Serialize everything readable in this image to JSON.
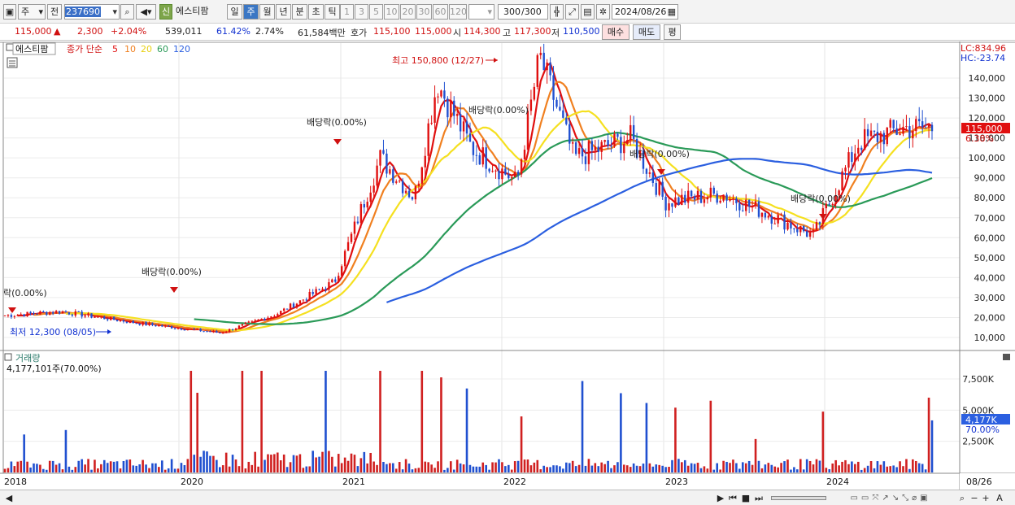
{
  "toolbar": {
    "market": "주",
    "jeon": "전",
    "code": "237690",
    "stock_name": "에스티팜",
    "shin": "신",
    "periods": [
      "일",
      "주",
      "월",
      "년",
      "분",
      "초",
      "틱"
    ],
    "selected_period": "주",
    "intervals": [
      "1",
      "3",
      "5",
      "10",
      "20",
      "30",
      "60",
      "120"
    ],
    "count": "300",
    "count_total": "/300",
    "date": "2024/08/26"
  },
  "info": {
    "price": "115,000",
    "arrow": "▲",
    "change": "2,300",
    "change_pct": "+2.04%",
    "volume": "539,011",
    "ratio1": "61.42%",
    "ratio2": "2.74%",
    "amount": "61,584백만",
    "hoga_label": "호가",
    "hoga1": "115,100",
    "hoga2": "115,000",
    "open_label": "시",
    "open": "114,300",
    "high_label": "고",
    "high": "117,300",
    "low_label": "저",
    "low": "110,500",
    "buy": "매수",
    "sell": "매도",
    "eval": "평"
  },
  "legend": {
    "name": "에스티팜",
    "series": "종가 단순",
    "periods": [
      "5",
      "10",
      "20",
      "60",
      "120"
    ],
    "colors": [
      "#e01010",
      "#f08020",
      "#f5e020",
      "#2a9a58",
      "#2b5fe0"
    ]
  },
  "price_chart": {
    "lc": "LC:834.96",
    "hc": "HC:-23.74",
    "y_ticks": [
      "140,000",
      "130,000",
      "120,000",
      "110,000",
      "100,000",
      "90,000",
      "80,000",
      "70,000",
      "60,000",
      "50,000",
      "40,000",
      "30,000",
      "20,000",
      "10,000"
    ],
    "current_price": "115,000",
    "current_pct": "6.38%",
    "annotations": {
      "high": "최고 150,800 (12/27)",
      "low": "최저 12,300 (08/05)",
      "div1": "락(0.00%)",
      "div2": "배당락(0.00%)",
      "div3": "배당락(0.00%)",
      "div4": "배당락(0.00%)",
      "div5": "배당락(0.00%)",
      "div6": "배당락(0.00%)"
    }
  },
  "volume_chart": {
    "title": "거래량",
    "value": "4,177,101주(70.00%)",
    "y_ticks": [
      "7,500K",
      "5,000K",
      "2,500K"
    ],
    "current": "4,177K",
    "current_pct": "70.00%"
  },
  "x_axis": {
    "labels": [
      "2018",
      "2020",
      "2021",
      "2022",
      "2023",
      "2024"
    ],
    "right_label": "08/26"
  },
  "chart_data": {
    "type": "candlestick",
    "weekly_close_approx": [
      {
        "date": "2018-01",
        "value": 21000
      },
      {
        "date": "2018-06",
        "value": 23000
      },
      {
        "date": "2019-01",
        "value": 17000
      },
      {
        "date": "2019-08",
        "value": 12300
      },
      {
        "date": "2020-01",
        "value": 22000
      },
      {
        "date": "2020-06",
        "value": 38000
      },
      {
        "date": "2020-10",
        "value": 100000
      },
      {
        "date": "2021-01",
        "value": 80000
      },
      {
        "date": "2021-03",
        "value": 138000
      },
      {
        "date": "2021-06",
        "value": 105000
      },
      {
        "date": "2021-10",
        "value": 88000
      },
      {
        "date": "2021-12",
        "value": 150800
      },
      {
        "date": "2022-03",
        "value": 100000
      },
      {
        "date": "2022-08",
        "value": 110000
      },
      {
        "date": "2022-11",
        "value": 78000
      },
      {
        "date": "2023-04",
        "value": 82000
      },
      {
        "date": "2023-08",
        "value": 72000
      },
      {
        "date": "2023-12",
        "value": 61000
      },
      {
        "date": "2024-04",
        "value": 108000
      },
      {
        "date": "2024-08",
        "value": 115000
      }
    ],
    "high": {
      "value": 150800,
      "date": "12/27"
    },
    "low": {
      "value": 12300,
      "date": "08/05"
    },
    "ylim": [
      5000,
      155000
    ]
  }
}
